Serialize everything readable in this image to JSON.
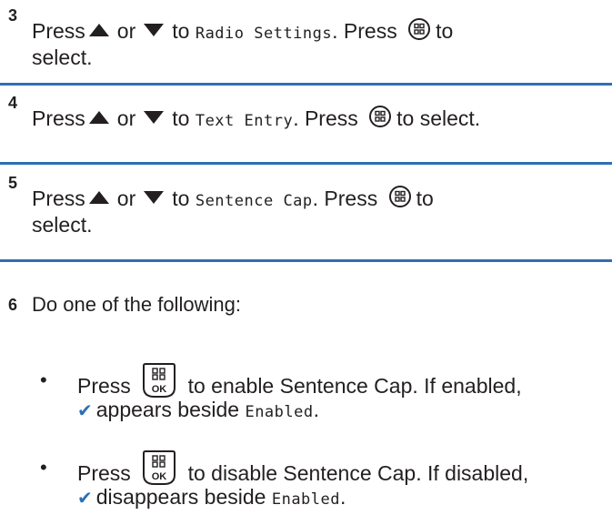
{
  "steps": [
    {
      "number": "3",
      "press": "Press",
      "or": "or",
      "to": "to",
      "menu_item": "Radio Settings",
      "press_again": ". Press",
      "to_select_a": "to",
      "to_select_b": "select."
    },
    {
      "number": "4",
      "press": "Press",
      "or": "or",
      "to": "to",
      "menu_item": "Text Entry",
      "press_again": ". Press",
      "to_select": "to select."
    },
    {
      "number": "5",
      "press": "Press",
      "or": "or",
      "to": "to",
      "menu_item": "Sentence Cap",
      "press_again": ". Press",
      "to_select_a": "to",
      "to_select_b": "select."
    },
    {
      "number": "6",
      "intro": "Do one of the following:",
      "options": [
        {
          "bullet": "•",
          "press": "Press",
          "action": "to enable Sentence Cap. If enabled,",
          "result": "appears beside",
          "target": "Enabled",
          "end": "."
        },
        {
          "bullet": "•",
          "press": "Press",
          "action": "to disable Sentence Cap. If disabled,",
          "result": "disappears beside",
          "target": "Enabled",
          "end": "."
        }
      ]
    }
  ],
  "icons": {
    "up": "up-arrow-key-icon",
    "down": "down-arrow-key-icon",
    "menu": "menu-ok-button-icon",
    "ok": "ok-key-icon",
    "check": "checkmark-icon"
  },
  "colors": {
    "divider": "#2e6fb4",
    "check": "#2e6fb4",
    "text": "#231f20"
  }
}
